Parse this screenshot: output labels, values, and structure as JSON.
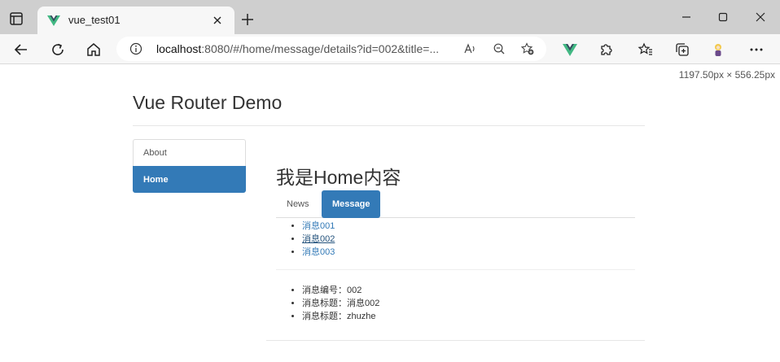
{
  "browser": {
    "tab_title": "vue_test01",
    "url_host": "localhost",
    "url_rest": ":8080/#/home/message/details?id=002&title=...",
    "viewport_dims": "1197.50px × 556.25px",
    "accent": "#42b883"
  },
  "page": {
    "title": "Vue Router Demo",
    "nav": [
      {
        "label": "About"
      },
      {
        "label": "Home",
        "active": true
      }
    ],
    "home_heading": "我是Home内容",
    "tabs": [
      {
        "label": "News"
      },
      {
        "label": "Message",
        "active": true
      }
    ],
    "messages": [
      {
        "label": "消息001"
      },
      {
        "label": "消息002",
        "active": true
      },
      {
        "label": "消息003"
      }
    ],
    "details": [
      {
        "text": "消息编号：002"
      },
      {
        "text": "消息标题：消息002"
      },
      {
        "text": "消息标题：zhuzhe"
      }
    ]
  },
  "colors": {
    "primary": "#337ab7",
    "link": "#337ab7",
    "link_active": "#23527c"
  }
}
